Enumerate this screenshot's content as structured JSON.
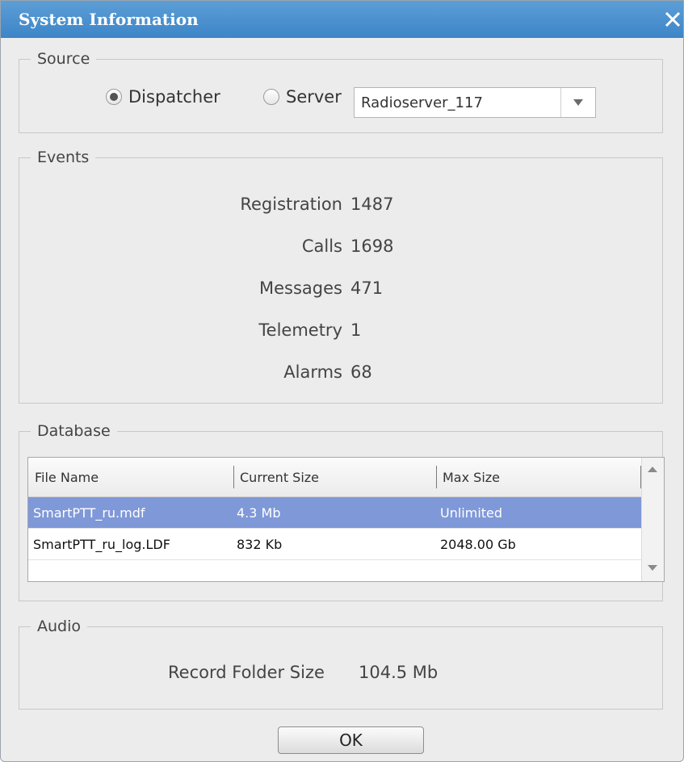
{
  "window": {
    "title": "System Information"
  },
  "source": {
    "legend": "Source",
    "options": [
      "Dispatcher",
      "Server"
    ],
    "selected": "Dispatcher",
    "server_value": "Radioserver_117"
  },
  "events": {
    "legend": "Events",
    "rows": [
      {
        "label": "Registration",
        "value": "1487"
      },
      {
        "label": "Calls",
        "value": "1698"
      },
      {
        "label": "Messages",
        "value": "471"
      },
      {
        "label": "Telemetry",
        "value": "1"
      },
      {
        "label": "Alarms",
        "value": "68"
      }
    ]
  },
  "database": {
    "legend": "Database",
    "columns": [
      "File Name",
      "Current Size",
      "Max Size"
    ],
    "rows": [
      {
        "file": "SmartPTT_ru.mdf",
        "current": "4.3 Mb",
        "max": "Unlimited",
        "selected": true
      },
      {
        "file": "SmartPTT_ru_log.LDF",
        "current": "832 Kb",
        "max": "2048.00 Gb",
        "selected": false
      }
    ]
  },
  "audio": {
    "legend": "Audio",
    "label": "Record Folder Size",
    "value": "104.5 Mb"
  },
  "buttons": {
    "ok": "OK"
  },
  "colors": {
    "titlebar": "#4a90d2",
    "selection": "#7f98d8",
    "background": "#ececec"
  }
}
